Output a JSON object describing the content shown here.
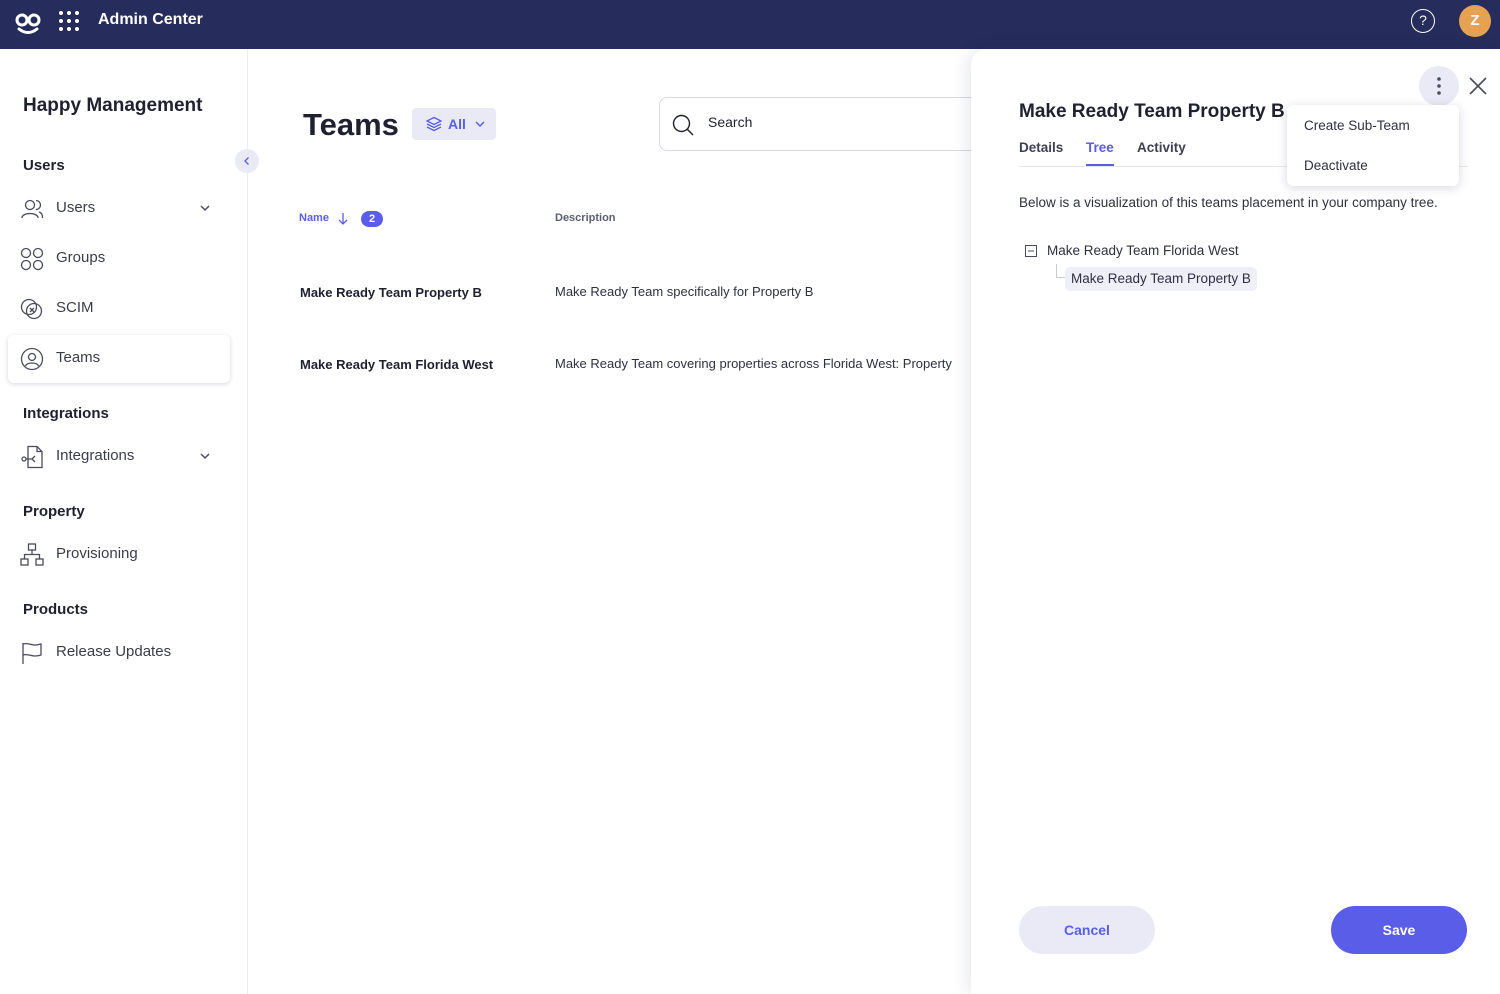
{
  "topbar": {
    "app_title": "Admin Center",
    "help_symbol": "?",
    "avatar_initial": "Z",
    "avatar_color": "#e6a252",
    "bar_color": "#262c5c"
  },
  "sidebar": {
    "org_name": "Happy Management",
    "sections": [
      {
        "title": "Users",
        "items": [
          {
            "label": "Users",
            "icon": "user-icon",
            "expandable": true
          },
          {
            "label": "Groups",
            "icon": "groups-icon",
            "expandable": false
          },
          {
            "label": "SCIM",
            "icon": "scim-icon",
            "expandable": false
          },
          {
            "label": "Teams",
            "icon": "team-icon",
            "expandable": false,
            "active": true
          }
        ]
      },
      {
        "title": "Integrations",
        "items": [
          {
            "label": "Integrations",
            "icon": "integrations-icon",
            "expandable": true
          }
        ]
      },
      {
        "title": "Property",
        "items": [
          {
            "label": "Provisioning",
            "icon": "provisioning-icon",
            "expandable": false
          }
        ]
      },
      {
        "title": "Products",
        "items": [
          {
            "label": "Release Updates",
            "icon": "flag-icon",
            "expandable": false
          }
        ]
      }
    ]
  },
  "main": {
    "title": "Teams",
    "filter_label": "All",
    "search": {
      "placeholder": "Search",
      "value": ""
    },
    "table": {
      "columns": {
        "name": "Name",
        "description": "Description"
      },
      "count": "2",
      "rows": [
        {
          "name": "Make Ready Team Property B",
          "description": "Make Ready Team specifically for Property B"
        },
        {
          "name": "Make Ready Team Florida West",
          "description": "Make Ready Team covering properties across Florida West: Property"
        }
      ]
    }
  },
  "panel": {
    "title": "Make Ready Team Property B",
    "tabs": [
      {
        "label": "Details"
      },
      {
        "label": "Tree",
        "active": true
      },
      {
        "label": "Activity"
      }
    ],
    "description": "Below is a visualization of this teams placement in your company tree.",
    "tree": {
      "root": "Make Ready Team Florida West",
      "child": "Make Ready Team Property B"
    },
    "cancel_label": "Cancel",
    "save_label": "Save"
  },
  "menu": {
    "items": [
      "Create Sub-Team",
      "Deactivate"
    ]
  },
  "colors": {
    "accent": "#5a5de8",
    "accent_light": "#e9eaf6"
  }
}
